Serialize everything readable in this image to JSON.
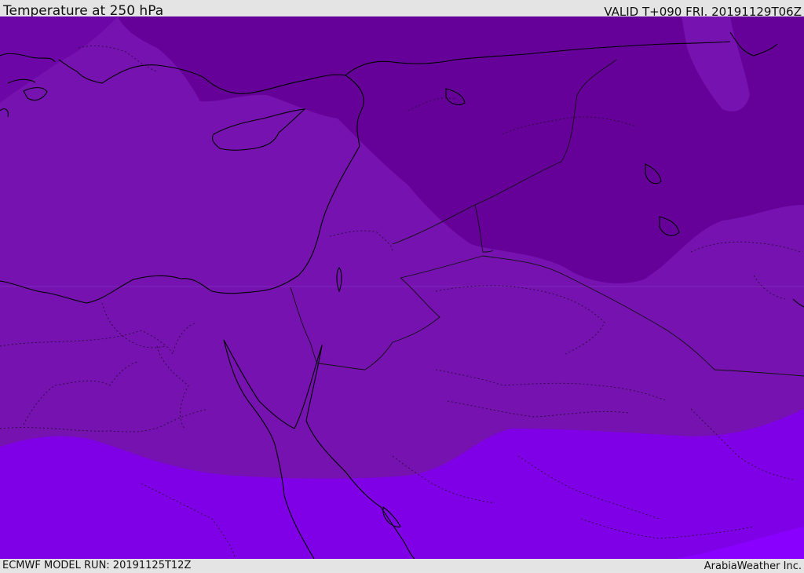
{
  "header": {
    "title": "Temperature at 250 hPa",
    "valid": "VALID T+090 FRI. 20191129T06Z"
  },
  "footer": {
    "model_run": "ECMWF MODEL RUN: 20191125T12Z",
    "brand": "ArabiaWeather Inc."
  },
  "map": {
    "fill_colors": {
      "coldest": "#650099",
      "cold": "#7512b0",
      "mid": "#7b0ed0",
      "warm": "#7f00e6",
      "warmest": "#8a00ff"
    },
    "coastline_color": "#000000",
    "border_color": "#1a1a1a"
  }
}
